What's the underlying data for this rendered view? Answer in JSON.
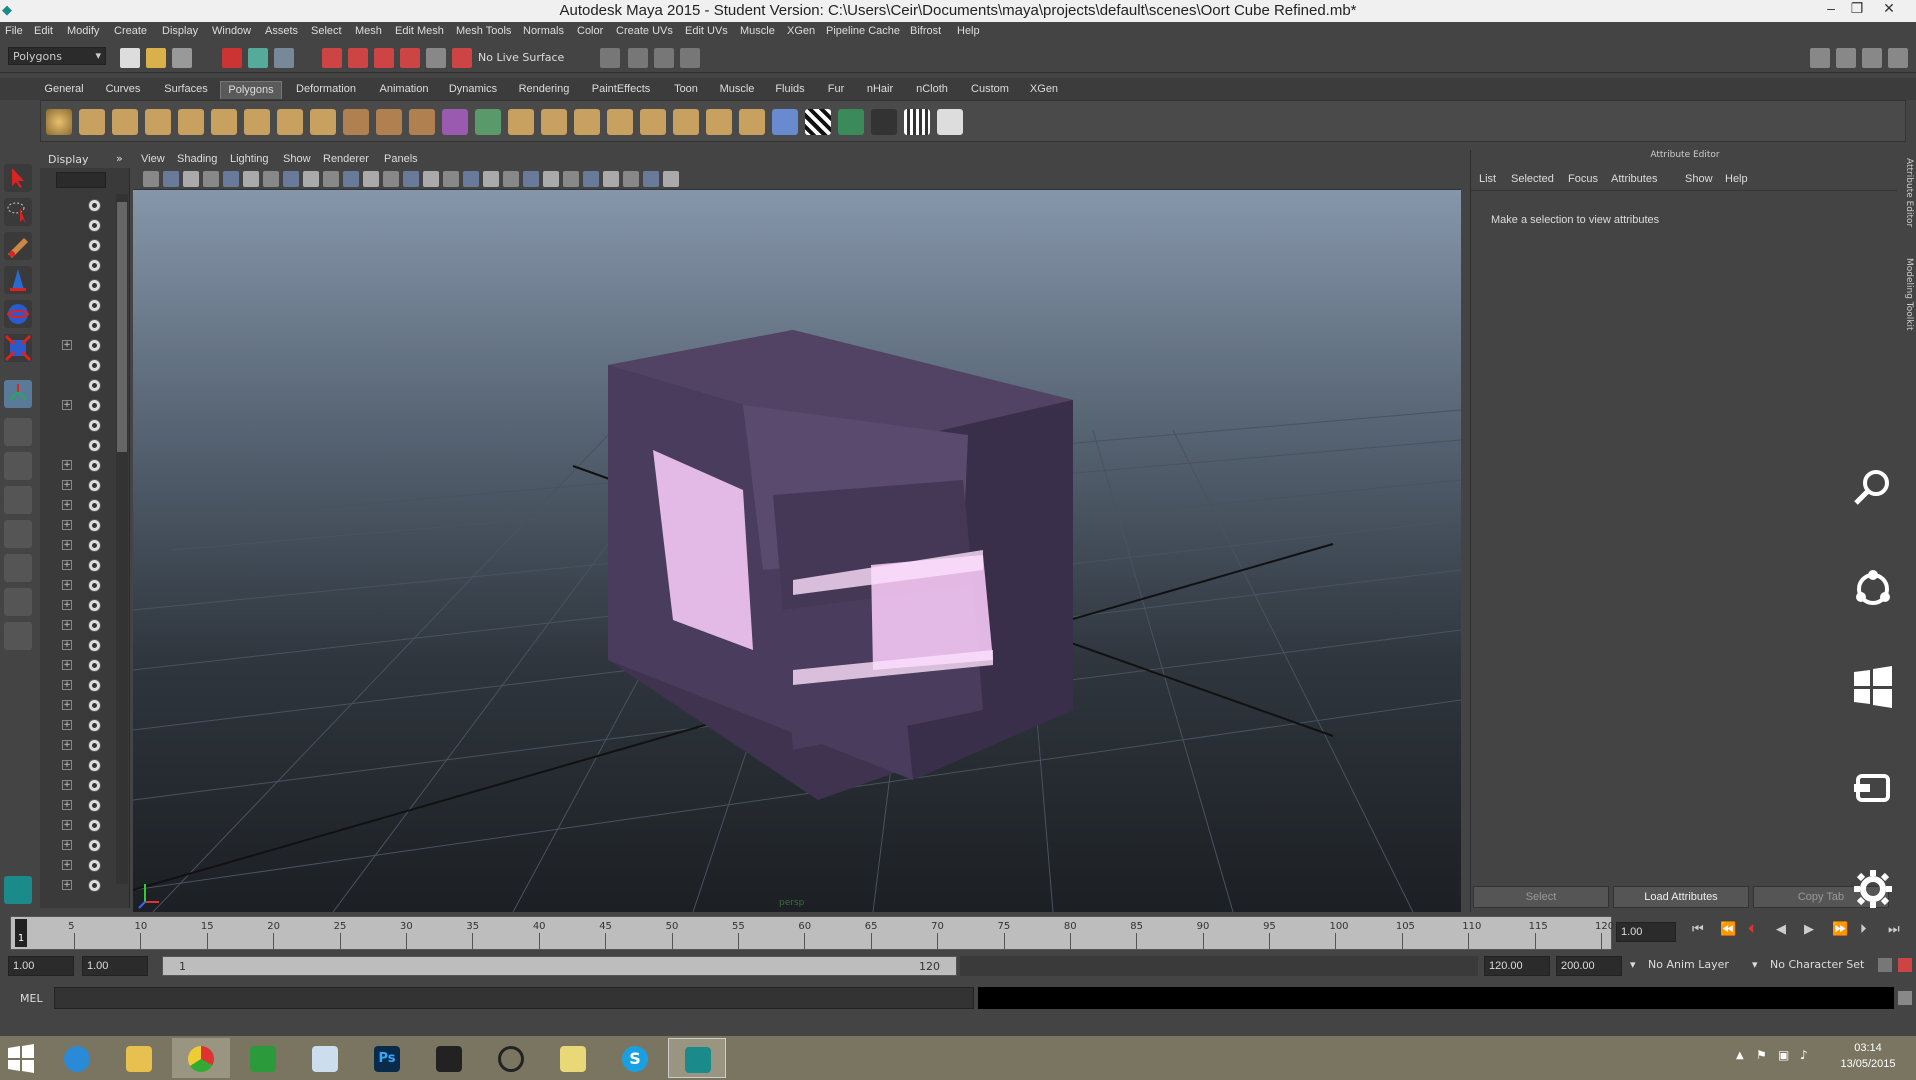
{
  "window": {
    "title": "Autodesk Maya 2015 - Student Version: C:\\Users\\Ceir\\Documents\\maya\\projects\\default\\scenes\\Oort Cube Refined.mb*",
    "minimize": "–",
    "restore": "❐",
    "close": "✕"
  },
  "menubar": [
    "File",
    "Edit",
    "Modify",
    "Create",
    "Display",
    "Window",
    "Assets",
    "Select",
    "Mesh",
    "Edit Mesh",
    "Mesh Tools",
    "Normals",
    "Color",
    "Create UVs",
    "Edit UVs",
    "Muscle",
    "XGen",
    "Pipeline Cache",
    "Bifrost",
    "Help"
  ],
  "statusline": {
    "mode_menu": "Polygons",
    "live_surface": "No Live Surface"
  },
  "shelf_tabs": [
    "General",
    "Curves",
    "Surfaces",
    "Polygons",
    "Deformation",
    "Animation",
    "Dynamics",
    "Rendering",
    "PaintEffects",
    "Toon",
    "Muscle",
    "Fluids",
    "Fur",
    "nHair",
    "nCloth",
    "Custom",
    "XGen"
  ],
  "shelf_active_tab": "Polygons",
  "outliner": {
    "header": "Display",
    "header_arrow": "»"
  },
  "viewport": {
    "menus": [
      "View",
      "Shading",
      "Lighting",
      "Show",
      "Renderer",
      "Panels"
    ],
    "camera_label": "persp"
  },
  "attribute_editor": {
    "title": "Attribute Editor",
    "menus": [
      "List",
      "Selected",
      "Focus",
      "Attributes",
      "Show",
      "Help"
    ],
    "message": "Make a selection to view attributes",
    "buttons": {
      "select": "Select",
      "load": "Load Attributes",
      "copy": "Copy Tab"
    },
    "side_tabs": [
      "Attribute Editor",
      "Modeling Toolkit"
    ]
  },
  "timeline": {
    "ticks": [
      "5",
      "10",
      "15",
      "20",
      "25",
      "30",
      "35",
      "40",
      "45",
      "50",
      "55",
      "60",
      "65",
      "70",
      "75",
      "80",
      "85",
      "90",
      "95",
      "100",
      "105",
      "110",
      "115",
      "120"
    ],
    "current_frame_marker": "1",
    "current_time": "1.00"
  },
  "range": {
    "start_time": "1.00",
    "playback_start": "1.00",
    "slider_start": "1",
    "slider_end": "120",
    "playback_end": "120.00",
    "end_time": "200.00",
    "anim_layer": "No Anim Layer",
    "character_set": "No Character Set"
  },
  "cmdline": {
    "label": "MEL"
  },
  "taskbar": {
    "time": "03:14",
    "date": "13/05/2015"
  },
  "colors": {
    "cube_body": "#4a3c58",
    "cube_glow": "#f4c8f4",
    "ui_bg": "#444444"
  }
}
